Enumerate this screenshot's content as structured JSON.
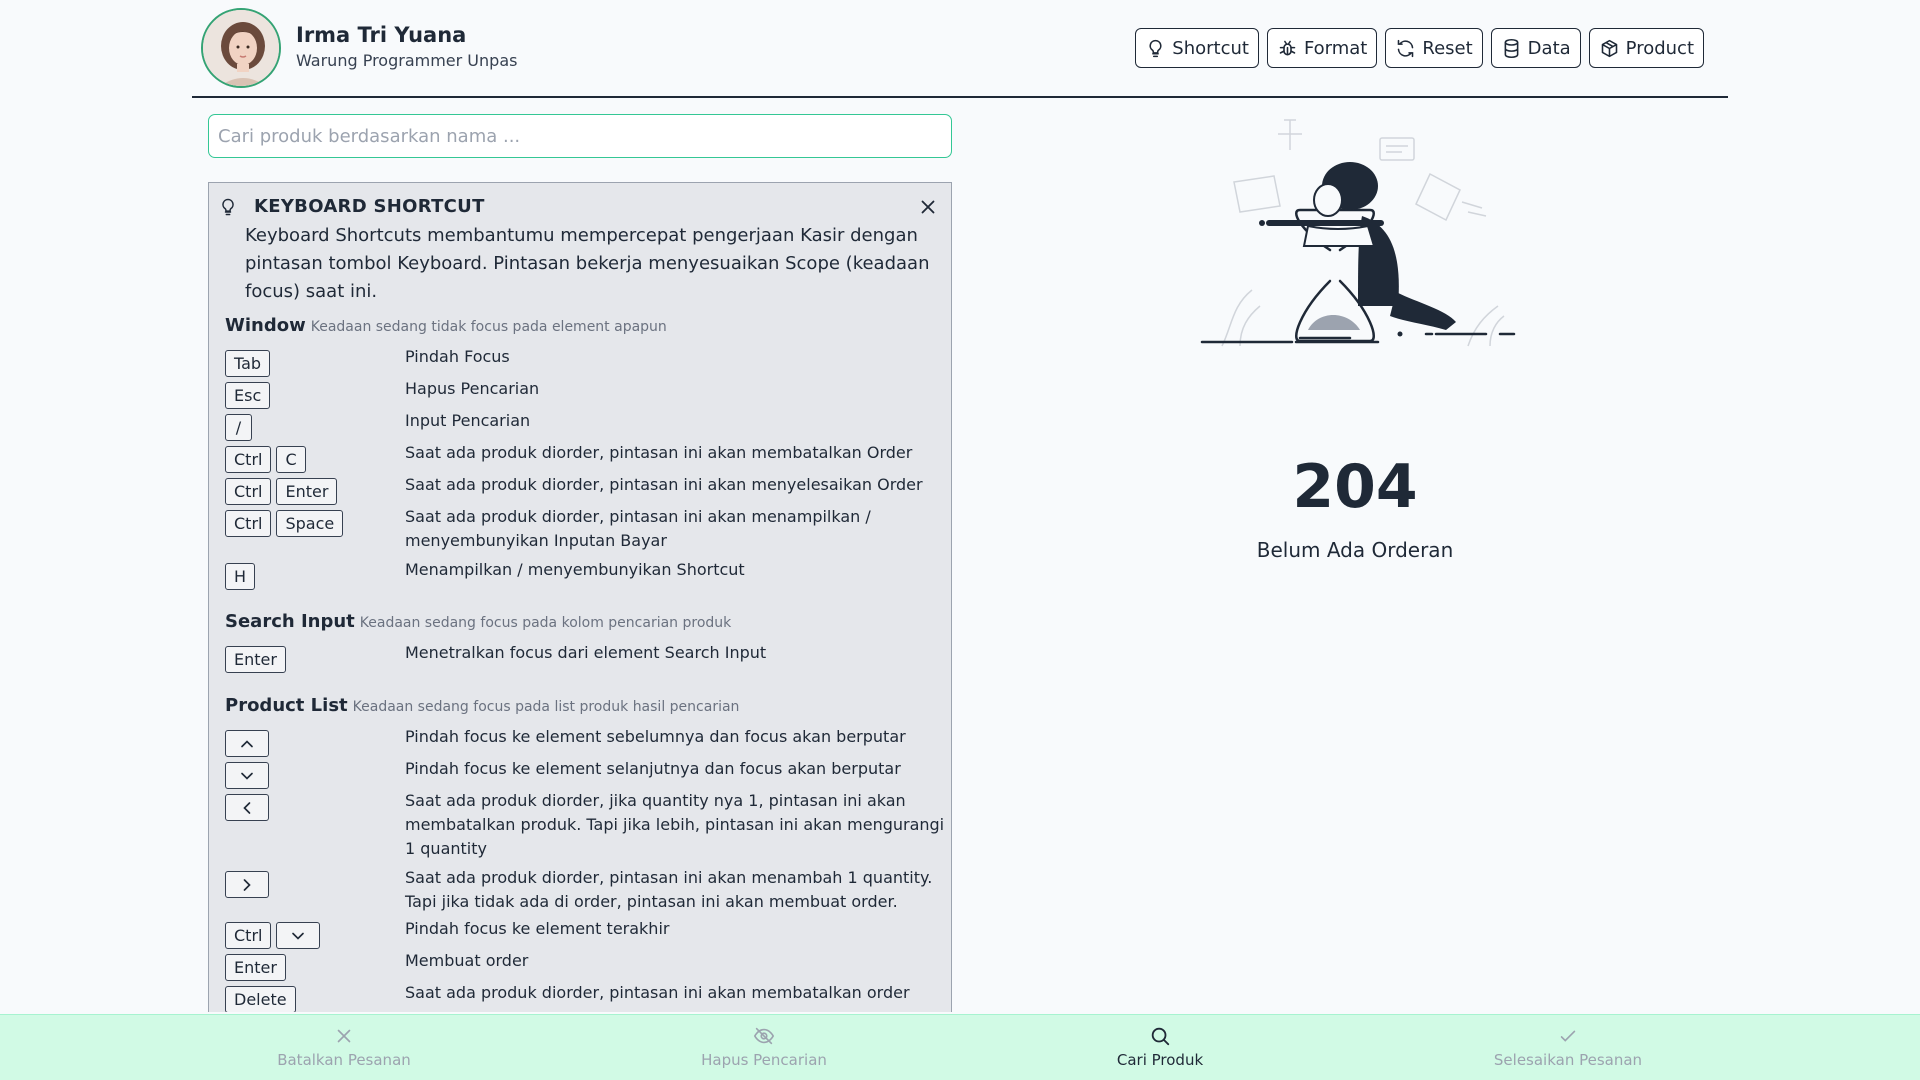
{
  "header": {
    "user_name": "Irma Tri Yuana",
    "shop_name": "Warung Programmer Unpas",
    "nav": [
      {
        "label": "Shortcut",
        "icon": "lightbulb-icon"
      },
      {
        "label": "Format",
        "icon": "bug-icon"
      },
      {
        "label": "Reset",
        "icon": "refresh-icon"
      },
      {
        "label": "Data",
        "icon": "database-icon"
      },
      {
        "label": "Product",
        "icon": "box-icon"
      }
    ]
  },
  "search": {
    "placeholder": "Cari produk berdasarkan nama ...",
    "value": ""
  },
  "shortcut_panel": {
    "title": "KEYBOARD SHORTCUT",
    "description": "Keyboard Shortcuts membantumu mempercepat pengerjaan Kasir dengan pintasan tombol Keyboard. Pintasan bekerja menyesuaikan Scope (keadaan focus) saat ini.",
    "sections": [
      {
        "title": "Window",
        "subtitle": "Keadaan sedang tidak focus pada element apapun",
        "rows": [
          {
            "keys": [
              "Tab"
            ],
            "desc": "Pindah Focus"
          },
          {
            "keys": [
              "Esc"
            ],
            "desc": "Hapus Pencarian"
          },
          {
            "keys": [
              "/"
            ],
            "desc": "Input Pencarian"
          },
          {
            "keys": [
              "Ctrl",
              "C"
            ],
            "desc": "Saat ada produk diorder, pintasan ini akan membatalkan Order"
          },
          {
            "keys": [
              "Ctrl",
              "Enter"
            ],
            "desc": "Saat ada produk diorder, pintasan ini akan menyelesaikan Order"
          },
          {
            "keys": [
              "Ctrl",
              "Space"
            ],
            "desc": "Saat ada produk diorder, pintasan ini akan menampilkan / menyembunyikan Inputan Bayar"
          },
          {
            "keys": [
              "H"
            ],
            "desc": "Menampilkan / menyembunyikan Shortcut"
          }
        ]
      },
      {
        "title": "Search Input",
        "subtitle": "Keadaan sedang focus pada kolom pencarian produk",
        "rows": [
          {
            "keys": [
              "Enter"
            ],
            "desc": "Menetralkan focus dari element Search Input"
          }
        ]
      },
      {
        "title": "Product List",
        "subtitle": "Keadaan sedang focus pada list produk hasil pencarian",
        "rows": [
          {
            "keys": [
              "arrow-up-icon"
            ],
            "desc": "Pindah focus ke element sebelumnya dan focus akan berputar"
          },
          {
            "keys": [
              "arrow-down-icon"
            ],
            "desc": "Pindah focus ke element selanjutnya dan focus akan berputar"
          },
          {
            "keys": [
              "arrow-left-icon"
            ],
            "desc": "Saat ada produk diorder, jika quantity nya 1, pintasan ini akan membatalkan produk. Tapi jika lebih, pintasan ini akan mengurangi 1 quantity"
          },
          {
            "keys": [
              "arrow-right-icon"
            ],
            "desc": "Saat ada produk diorder, pintasan ini akan menambah 1 quantity. Tapi jika tidak ada di order, pintasan ini akan membuat order."
          },
          {
            "keys": [
              "Ctrl",
              "arrow-down-icon"
            ],
            "desc": "Pindah focus ke element terakhir"
          },
          {
            "keys": [
              "Enter"
            ],
            "desc": "Membuat order"
          },
          {
            "keys": [
              "Delete"
            ],
            "desc": "Saat ada produk diorder, pintasan ini akan membatalkan order"
          }
        ]
      }
    ]
  },
  "order": {
    "count": "204",
    "empty_text": "Belum Ada Orderan"
  },
  "bottom_bar": {
    "items": [
      {
        "label": "Batalkan Pesanan",
        "icon": "close-icon",
        "state": "disabled"
      },
      {
        "label": "Hapus Pencarian",
        "icon": "eye-slash-icon",
        "state": "disabled"
      },
      {
        "label": "Cari Produk",
        "icon": "search-icon",
        "state": "active"
      },
      {
        "label": "Selesaikan Pesanan",
        "icon": "check-icon",
        "state": "disabled"
      }
    ]
  },
  "colors": {
    "accent": "#34c795",
    "bottom_bar_bg": "#d1fae5",
    "panel_bg": "#e5e7eb",
    "text": "#1f2937"
  }
}
